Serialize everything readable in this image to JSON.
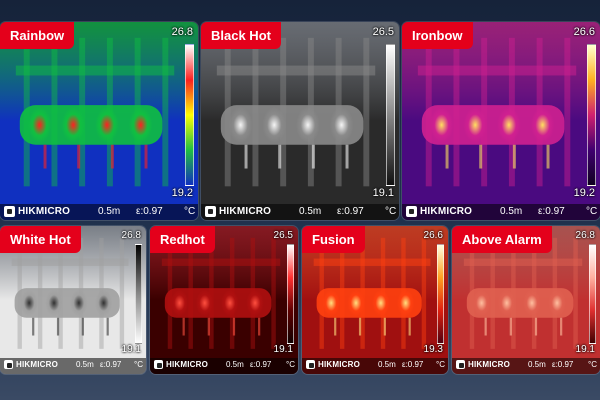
{
  "brand": "HIKMICRO",
  "panels": [
    {
      "label": "Rainbow",
      "max": "26.8",
      "min": "19.2",
      "distance": "0.5m",
      "emissivity": "ε:0.97",
      "unit": "°C",
      "palette": "rainbow"
    },
    {
      "label": "Black Hot",
      "max": "26.5",
      "min": "19.1",
      "distance": "0.5m",
      "emissivity": "ε:0.97",
      "unit": "°C",
      "palette": "blackhot"
    },
    {
      "label": "Ironbow",
      "max": "26.6",
      "min": "19.2",
      "distance": "0.5m",
      "emissivity": "ε:0.97",
      "unit": "°C",
      "palette": "ironbow"
    },
    {
      "label": "White Hot",
      "max": "26.8",
      "min": "19.1",
      "distance": "0.5m",
      "emissivity": "ε:0.97",
      "unit": "°C",
      "palette": "whitehot"
    },
    {
      "label": "Redhot",
      "max": "26.5",
      "min": "19.1",
      "distance": "0.5m",
      "emissivity": "ε:0.97",
      "unit": "°C",
      "palette": "redhot"
    },
    {
      "label": "Fusion",
      "max": "26.6",
      "min": "19.3",
      "distance": "0.5m",
      "emissivity": "ε:0.97",
      "unit": "°C",
      "palette": "fusion"
    },
    {
      "label": "Above Alarm",
      "max": "26.8",
      "min": "19.1",
      "distance": "0.5m",
      "emissivity": "ε:0.97",
      "unit": "°C",
      "palette": "alarm"
    }
  ],
  "palette_colors": {
    "rainbow": {
      "bg": "#1030c0",
      "mid": "#10c040",
      "hot": "#ff2020",
      "scale": [
        "#ffffff",
        "#ff2020",
        "#ffff00",
        "#20c040",
        "#1030c0"
      ]
    },
    "blackhot": {
      "bg": "#2a2a2a",
      "mid": "#8a8a8a",
      "hot": "#f5f5f5",
      "scale": [
        "#ffffff",
        "#888888",
        "#111111"
      ]
    },
    "ironbow": {
      "bg": "#4a0a80",
      "mid": "#d02090",
      "hot": "#ffe060",
      "scale": [
        "#ffffd0",
        "#ffb020",
        "#d02070",
        "#400070",
        "#100020"
      ]
    },
    "whitehot": {
      "bg": "#e8e8e8",
      "mid": "#a0a0a0",
      "hot": "#303030",
      "scale": [
        "#000000",
        "#888888",
        "#ffffff"
      ]
    },
    "redhot": {
      "bg": "#3a0000",
      "mid": "#b01010",
      "hot": "#ff5040",
      "scale": [
        "#ffffff",
        "#ff3030",
        "#600000",
        "#100000"
      ]
    },
    "fusion": {
      "bg": "#a01010",
      "mid": "#ff4010",
      "hot": "#ffe080",
      "scale": [
        "#ffffe0",
        "#ffa020",
        "#e02010",
        "#500010"
      ]
    },
    "alarm": {
      "bg": "#c03030",
      "mid": "#e06050",
      "hot": "#ffc0a0",
      "scale": [
        "#ffffff",
        "#ffb0a0",
        "#e03030",
        "#400000"
      ]
    }
  }
}
